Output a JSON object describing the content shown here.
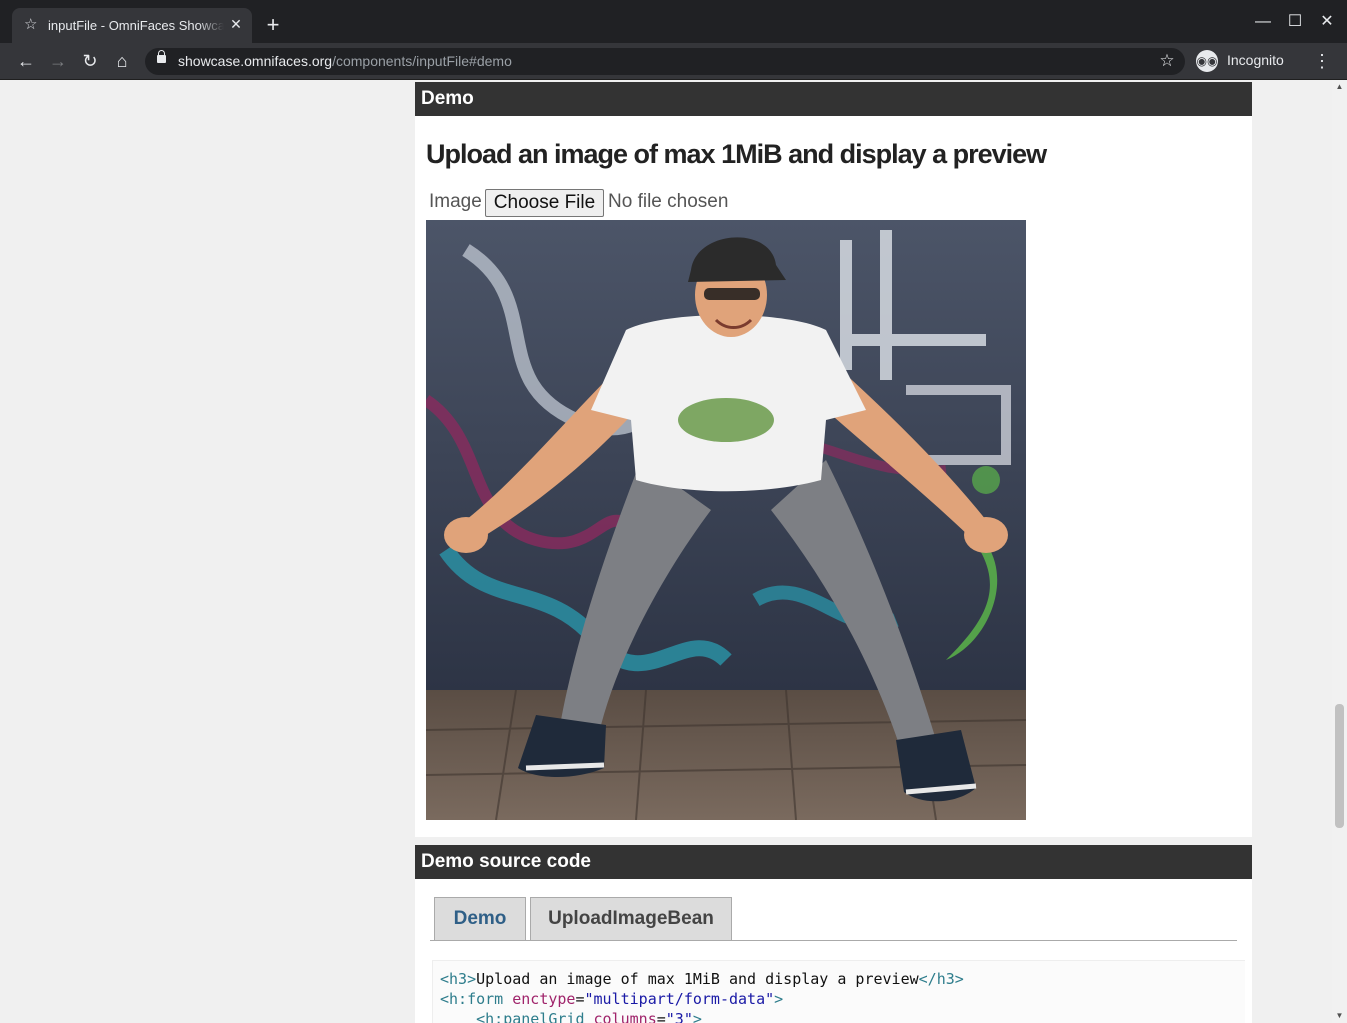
{
  "browser": {
    "tab_title": "inputFile - OmniFaces Showcase",
    "tab_close": "✕",
    "new_tab": "+",
    "url_host": "showcase.omnifaces.org",
    "url_path": "/components/inputFile#demo",
    "incognito_label": "Incognito",
    "window_controls": {
      "minimize": "—",
      "maximize": "☐",
      "close": "✕"
    }
  },
  "demo_panel": {
    "header": "Demo",
    "title": "Upload an image of max 1MiB and display a preview",
    "field_label": "Image",
    "file_button": "Choose File",
    "file_status": "No file chosen"
  },
  "source_panel": {
    "header": "Demo source code",
    "tabs": [
      {
        "label": "Demo",
        "active": true
      },
      {
        "label": "UploadImageBean",
        "active": false
      }
    ],
    "code": {
      "line1_open": "<h3>",
      "line1_text": "Upload an image of max 1MiB and display a preview",
      "line1_close": "</h3>",
      "line2_tag": "<h:form",
      "line2_attr": "enctype",
      "line2_eq": "=",
      "line2_val": "\"multipart/form-data\"",
      "line2_end": ">",
      "line3_tag": "<h:panelGrid",
      "line3_attr": "columns",
      "line3_eq": "=",
      "line3_val": "\"3\"",
      "line3_end": ">"
    }
  },
  "colors": {
    "panel_header_bg": "#333333",
    "active_tab_text": "#2f5f87",
    "page_bg": "#f0f0f0"
  }
}
